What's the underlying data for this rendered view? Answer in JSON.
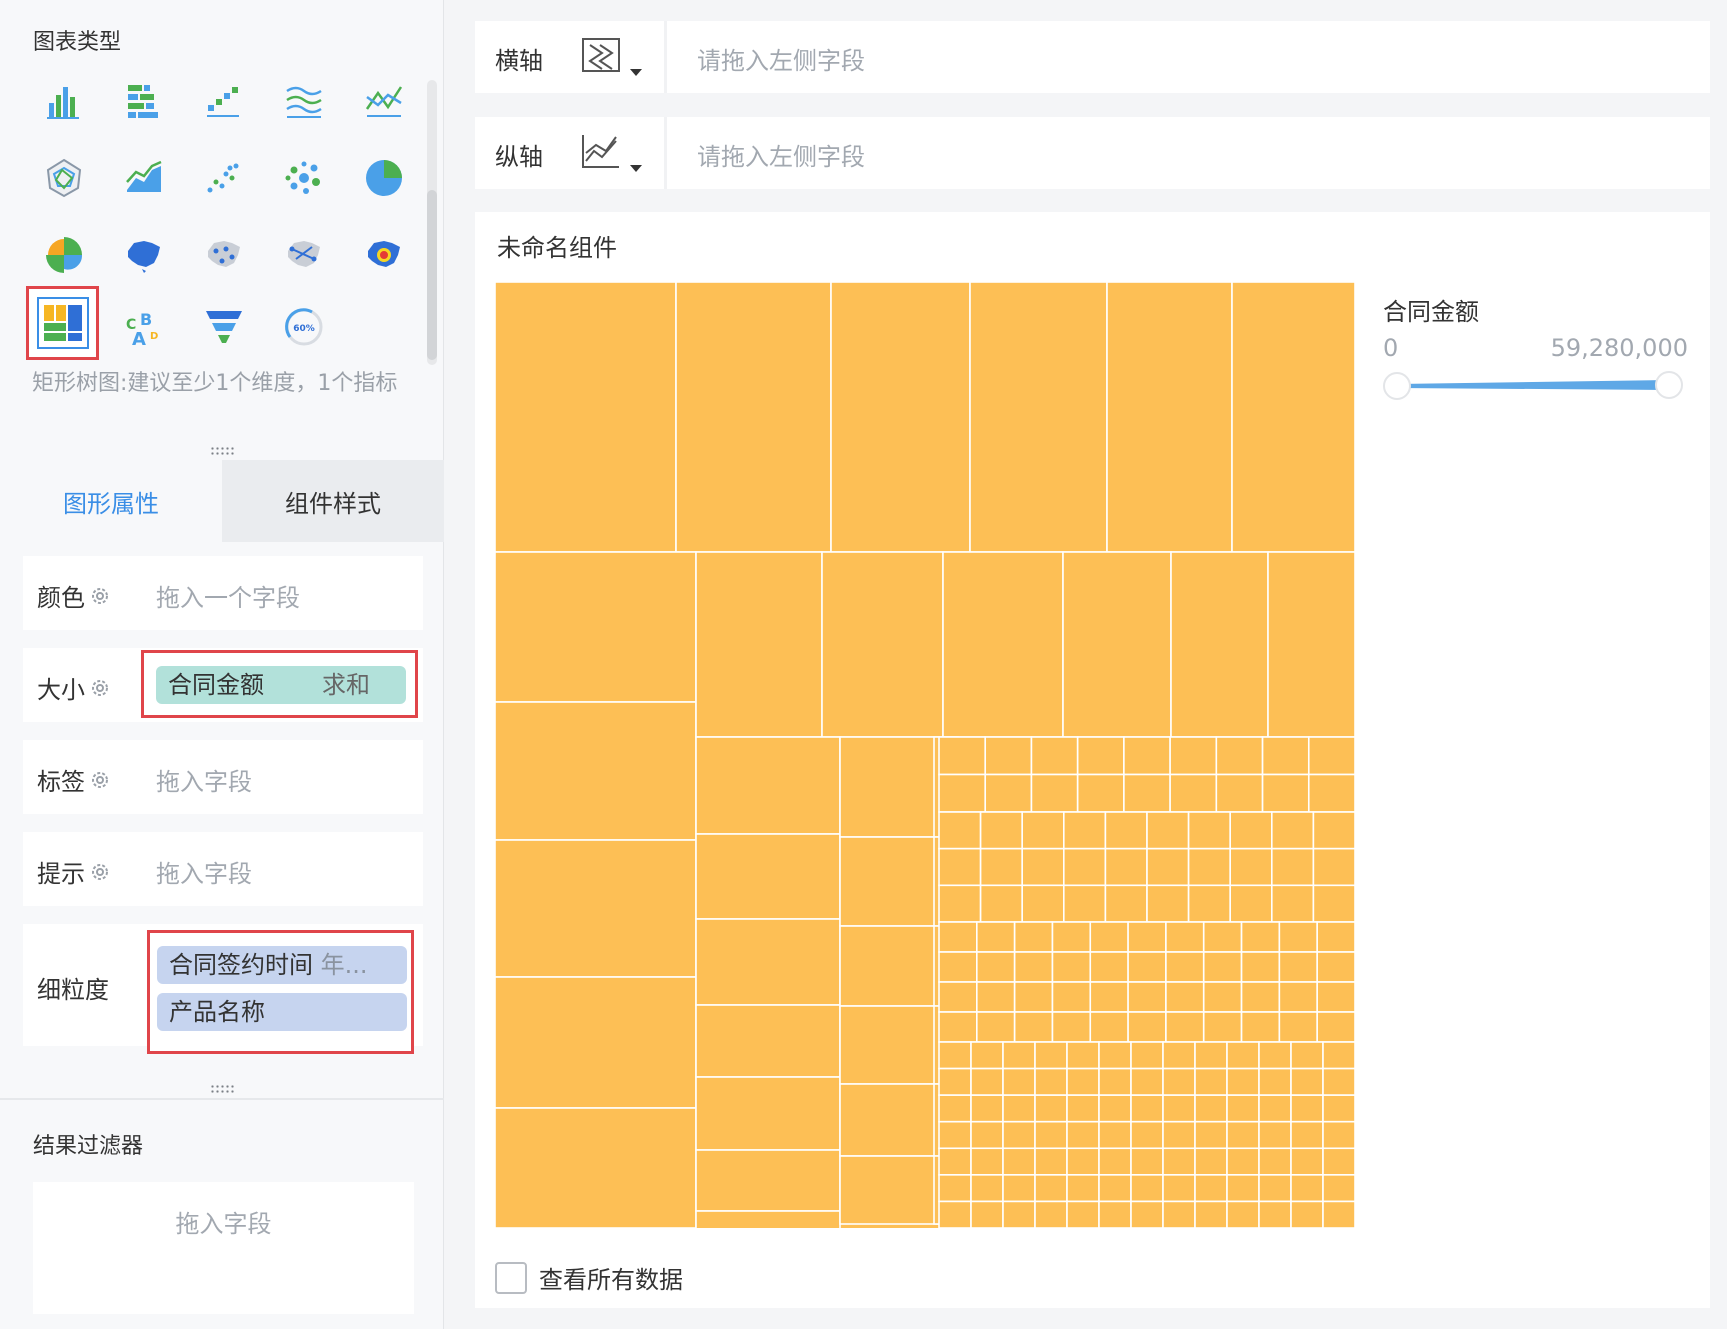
{
  "left_panel": {
    "chart_type_title": "图表类型",
    "chart_types": [
      {
        "icon": "bar-chart-icon"
      },
      {
        "icon": "grouped-bar-chart-icon"
      },
      {
        "icon": "range-bar-chart-icon"
      },
      {
        "icon": "wave-area-chart-icon"
      },
      {
        "icon": "line-chart-icon"
      },
      {
        "icon": "radar-chart-icon"
      },
      {
        "icon": "area-chart-icon"
      },
      {
        "icon": "scatter-chart-icon"
      },
      {
        "icon": "bubble-chart-icon"
      },
      {
        "icon": "pie-chart-icon"
      },
      {
        "icon": "rose-chart-icon"
      },
      {
        "icon": "region-map-icon"
      },
      {
        "icon": "point-map-icon"
      },
      {
        "icon": "flow-map-icon"
      },
      {
        "icon": "heat-map-icon"
      },
      {
        "icon": "treemap-icon",
        "selected": true
      },
      {
        "icon": "word-cloud-icon"
      },
      {
        "icon": "funnel-chart-icon"
      },
      {
        "icon": "gauge-chart-icon",
        "text": "60%"
      }
    ],
    "chart_hint": "矩形树图:建议至少1个维度，1个指标",
    "tabs": [
      "图形属性",
      "组件样式"
    ],
    "props": {
      "color": {
        "label": "颜色",
        "placeholder": "拖入一个字段"
      },
      "size": {
        "label": "大小",
        "field": "合同金额",
        "agg": "求和"
      },
      "label": {
        "label": "标签",
        "placeholder": "拖入字段"
      },
      "tooltip": {
        "label": "提示",
        "placeholder": "拖入字段"
      },
      "granularity": {
        "label": "细粒度",
        "fields": [
          "合同签约时间",
          "产品名称"
        ],
        "field_suffix": "年..."
      }
    },
    "result_filter": {
      "title": "结果过滤器",
      "placeholder": "拖入字段"
    }
  },
  "x_axis": {
    "label": "横轴",
    "placeholder": "请拖入左侧字段"
  },
  "y_axis": {
    "label": "纵轴",
    "placeholder": "请拖入左侧字段"
  },
  "widget": {
    "title": "未命名组件",
    "legend": {
      "title": "合同金额",
      "min": "0",
      "max": "59,280,000"
    },
    "view_all_label": "查看所有数据"
  },
  "colors": {
    "accent": "#3a8ee6",
    "treemap_fill": "#fdbf55",
    "highlight": "#e0454a",
    "teal_pill": "#b2e1da",
    "blue_pill": "#c6d4ef"
  }
}
